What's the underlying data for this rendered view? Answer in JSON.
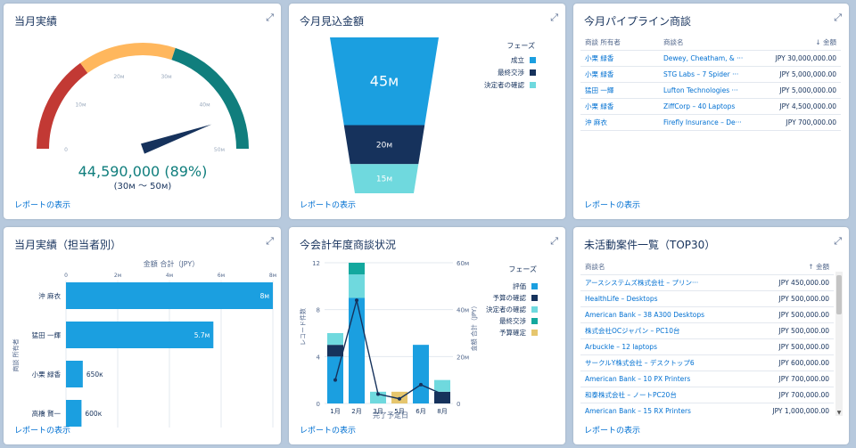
{
  "cards": {
    "gauge": {
      "title": "当月実績",
      "value_text": "44,590,000 (89%)",
      "range_text": "(30м 〜 50м)",
      "ticks": [
        "0",
        "10м",
        "20м",
        "30м",
        "40м",
        "50м"
      ],
      "report_link": "レポートの表示"
    },
    "funnel": {
      "title": "今月見込金額",
      "legend_title": "フェーズ",
      "report_link": "レポートの表示"
    },
    "pipeline": {
      "title": "今月パイプライン商談",
      "report_link": "レポートの表示",
      "headers": {
        "owner": "商談 所有者",
        "name": "商談名",
        "amount": "金額",
        "sort_icon": "↓"
      },
      "rows": [
        {
          "owner": "小栗 緑香",
          "name": "Dewey, Cheatham, & ···",
          "amount": "JPY 30,000,000.00"
        },
        {
          "owner": "小栗 緑香",
          "name": "STG Labs – 7 Spider ···",
          "amount": "JPY 5,000,000.00"
        },
        {
          "owner": "猛田 一輝",
          "name": "Lufton Technologies ···",
          "amount": "JPY 5,000,000.00"
        },
        {
          "owner": "小栗 緑香",
          "name": "ZiffCorp – 40 Laptops",
          "amount": "JPY 4,500,000.00"
        },
        {
          "owner": "沖 麻衣",
          "name": "Firefly Insurance – De···",
          "amount": "JPY 700,000.00"
        }
      ]
    },
    "byrep": {
      "title": "当月実績（担当者別）",
      "axis_title": "金額 合計（JPY）",
      "y_title": "商談 所有者",
      "ticks": [
        "0",
        "2м",
        "4м",
        "6м",
        "8м"
      ],
      "report_link": "レポートの表示"
    },
    "fiscal": {
      "title": "今会計年度商談状況",
      "legend_title": "フェーズ",
      "x_title": "完了予定日",
      "y_left_title": "レコード件数",
      "y_right_title": "金額 合計（JPY）",
      "left_ticks": [
        "0",
        "4",
        "8",
        "12"
      ],
      "right_ticks": [
        "0",
        "20м",
        "40м",
        "60м"
      ],
      "report_link": "レポートの表示"
    },
    "inactive": {
      "title": "未活動案件一覧（TOP30）",
      "report_link": "レポートの表示",
      "headers": {
        "name": "商談名",
        "amount": "金額",
        "sort_icon": "↑"
      },
      "rows": [
        {
          "name": "アースシステムズ株式会社 – プリン···",
          "amount": "JPY 450,000.00"
        },
        {
          "name": "HealthLife – Desktops",
          "amount": "JPY 500,000.00"
        },
        {
          "name": "American Bank – 38 A300 Desktops",
          "amount": "JPY 500,000.00"
        },
        {
          "name": "株式会社OCジャパン – PC10台",
          "amount": "JPY 500,000.00"
        },
        {
          "name": "Arbuckle – 12 laptops",
          "amount": "JPY 500,000.00"
        },
        {
          "name": "サークルY株式会社 – デスクトップ6",
          "amount": "JPY 600,000.00"
        },
        {
          "name": "American Bank – 10 PX Printers",
          "amount": "JPY 700,000.00"
        },
        {
          "name": "和泰株式会社 – ノートPC20台",
          "amount": "JPY 700,000.00"
        },
        {
          "name": "American Bank – 15 RX Printers",
          "amount": "JPY 1,000,000.00"
        }
      ]
    }
  },
  "chart_data": [
    {
      "type": "gauge",
      "title": "当月実績",
      "value": 44590000,
      "percent": 89,
      "min": 0,
      "max": 50000000,
      "range_low": 30000000,
      "range_high": 50000000,
      "bands": [
        {
          "to": 15000000,
          "color": "#c23934"
        },
        {
          "to": 30000000,
          "color": "#ffb75d"
        },
        {
          "to": 50000000,
          "color": "#107e7d"
        }
      ]
    },
    {
      "type": "funnel",
      "title": "今月見込金額",
      "stages": [
        {
          "label": "成立",
          "value": 45000000,
          "text": "45м",
          "color": "#1b9fe0"
        },
        {
          "label": "最終交渉",
          "value": 20000000,
          "text": "20м",
          "color": "#16325c"
        },
        {
          "label": "決定者の確認",
          "value": 15000000,
          "text": "15м",
          "color": "#6fd9de"
        }
      ]
    },
    {
      "type": "bar",
      "title": "当月実績（担当者別）",
      "orientation": "horizontal",
      "xlabel": "金額 合計（JPY）",
      "ylabel": "商談 所有者",
      "xlim": [
        0,
        8000000
      ],
      "categories": [
        "沖 麻衣",
        "猛田 一輝",
        "小栗 緑香",
        "高橋 賢一"
      ],
      "values": [
        8000000,
        5700000,
        650000,
        600000
      ],
      "labels": [
        "8м",
        "5.7м",
        "650к",
        "600к"
      ],
      "color": "#1b9fe0"
    },
    {
      "type": "bar",
      "title": "今会計年度商談状況",
      "stacked": true,
      "xlabel": "完了予定日",
      "ylabel": "レコード件数",
      "ylim": [
        0,
        12
      ],
      "y2label": "金額 合計（JPY）",
      "y2lim": [
        0,
        60000000
      ],
      "categories": [
        "1月",
        "2月",
        "3月",
        "5月",
        "6月",
        "8月"
      ],
      "series": [
        {
          "name": "評価",
          "color": "#1b9fe0",
          "values": [
            4,
            9,
            0,
            0,
            5,
            0
          ]
        },
        {
          "name": "予算の確認",
          "color": "#16325c",
          "values": [
            1,
            0,
            0,
            0,
            0,
            1
          ]
        },
        {
          "name": "決定者の確認",
          "color": "#6fd9de",
          "values": [
            1,
            2,
            1,
            0,
            0,
            1
          ]
        },
        {
          "name": "最終交渉",
          "color": "#13a89e",
          "values": [
            0,
            1,
            0,
            0,
            0,
            0
          ]
        },
        {
          "name": "予算確定",
          "color": "#e6c66e",
          "values": [
            0,
            0,
            0,
            1,
            0,
            0
          ]
        }
      ],
      "line": {
        "values": [
          10000000,
          44000000,
          4000000,
          2000000,
          8000000,
          4000000
        ]
      }
    }
  ]
}
